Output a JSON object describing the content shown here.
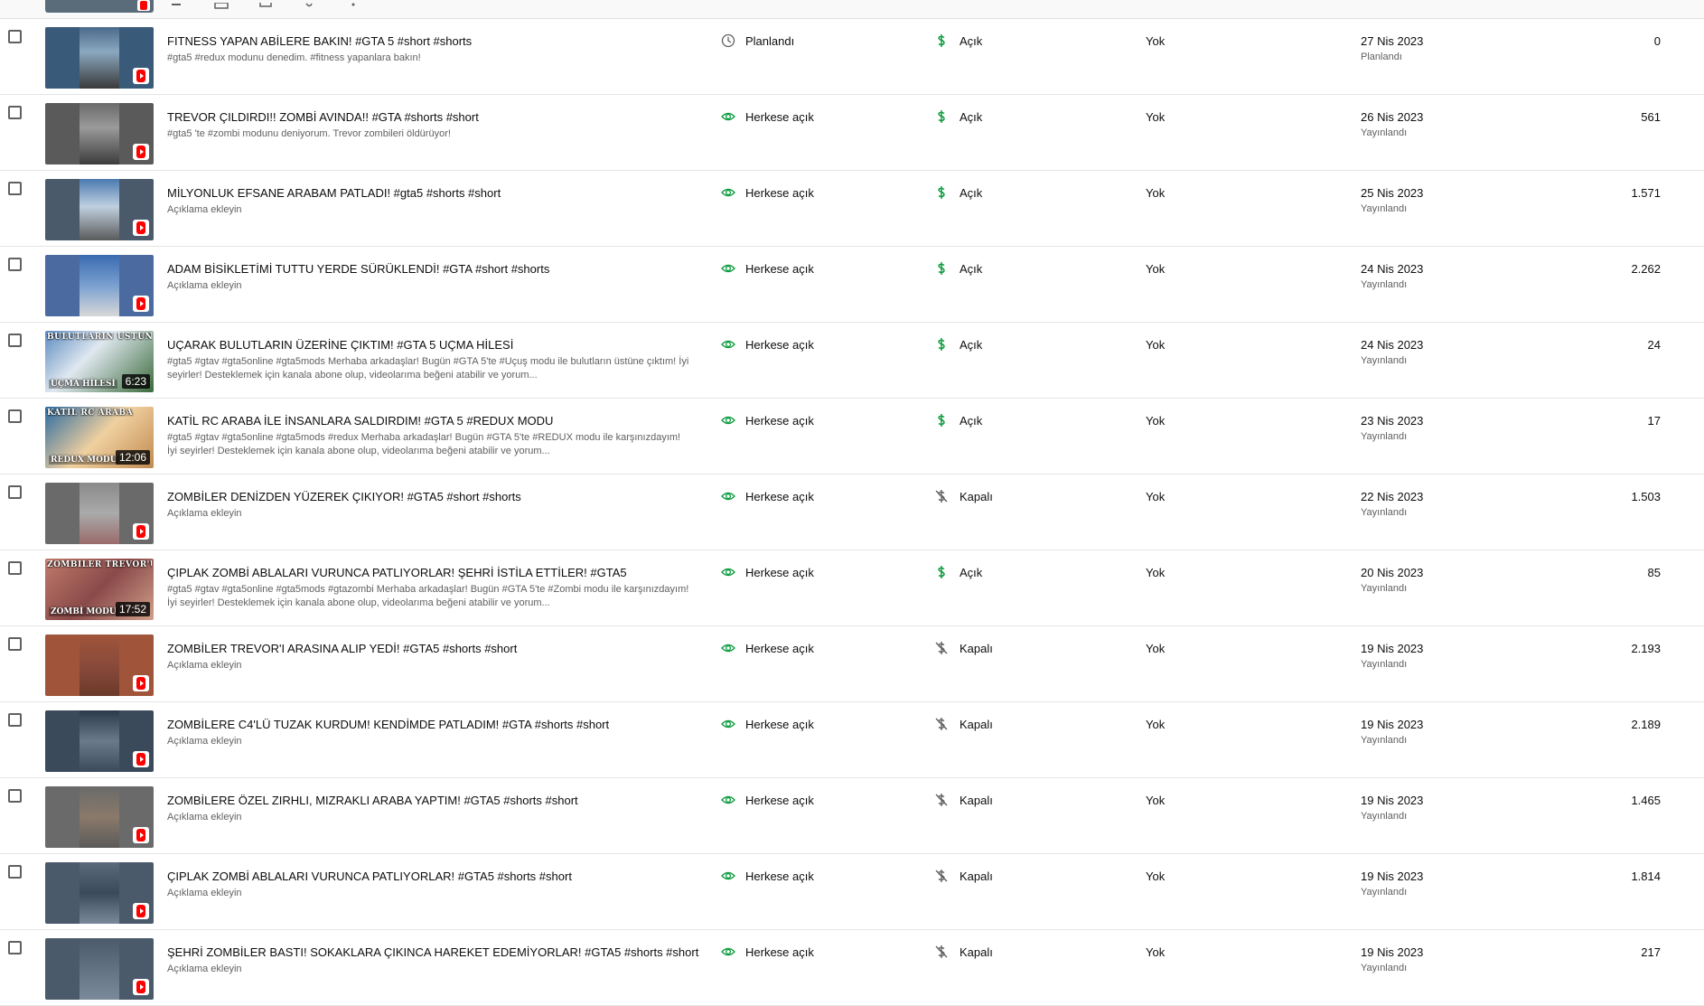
{
  "colors": {
    "money_on": "#0a9b3c",
    "icon_grey": "#606060",
    "shorts_red": "#ff0000"
  },
  "rows": [
    {
      "title": "FITNESS YAPAN ABİLERE BAKIN! #GTA 5 #short #shorts",
      "desc": "#gta5 #redux modunu denedim. #fitness yapanlara bakın!",
      "vis_icon": "clock-icon",
      "vis": "Planlandı",
      "mon_icon": "dollar-icon",
      "mon": "Açık",
      "restr": "Yok",
      "date": "27 Nis 2023",
      "status": "Planlandı",
      "views": "0",
      "thumb": "short"
    },
    {
      "title": "TREVOR ÇILDIRDI!! ZOMBİ AVINDA!! #GTA #shorts #short",
      "desc": "#gta5 'te #zombi modunu deniyorum. Trevor zombileri öldürüyor!",
      "vis_icon": "eye-icon",
      "vis": "Herkese açık",
      "mon_icon": "dollar-icon",
      "mon": "Açık",
      "restr": "Yok",
      "date": "26 Nis 2023",
      "status": "Yayınlandı",
      "views": "561",
      "thumb": "short"
    },
    {
      "title": "MİLYONLUK EFSANE ARABAM PATLADI! #gta5 #shorts #short",
      "desc": "Açıklama ekleyin",
      "vis_icon": "eye-icon",
      "vis": "Herkese açık",
      "mon_icon": "dollar-icon",
      "mon": "Açık",
      "restr": "Yok",
      "date": "25 Nis 2023",
      "status": "Yayınlandı",
      "views": "1.571",
      "thumb": "short"
    },
    {
      "title": "ADAM BİSİKLETİMİ TUTTU YERDE SÜRÜKLENDİ! #GTA #short #shorts",
      "desc": "Açıklama ekleyin",
      "vis_icon": "eye-icon",
      "vis": "Herkese açık",
      "mon_icon": "dollar-icon",
      "mon": "Açık",
      "restr": "Yok",
      "date": "24 Nis 2023",
      "status": "Yayınlandı",
      "views": "2.262",
      "thumb": "short"
    },
    {
      "title": "UÇARAK BULUTLARIN ÜZERİNE ÇIKTIM! #GTA 5 UÇMA HİLESİ",
      "desc": "#gta5 #gtav #gta5online #gta5mods Merhaba arkadaşlar! Bugün #GTA 5'te #Uçuş modu ile bulutların üstüne çıktım! İyi seyirler! Desteklemek için kanala abone olup, videolarıma beğeni atabilir ve yorum...",
      "vis_icon": "eye-icon",
      "vis": "Herkese açık",
      "mon_icon": "dollar-icon",
      "mon": "Açık",
      "restr": "Yok",
      "date": "24 Nis 2023",
      "status": "Yayınlandı",
      "views": "24",
      "thumb": "video",
      "duration": "6:23",
      "overlay_top": "BULUTLARIN ÜSTÜNE ÇIKTIM",
      "overlay_bot": "UÇMA HİLESİ"
    },
    {
      "title": "KATİL RC ARABA İLE İNSANLARA SALDIRDIM! #GTA 5 #REDUX MODU",
      "desc": "#gta5 #gtav #gta5online #gta5mods #redux Merhaba arkadaşlar! Bugün #GTA 5'te #REDUX modu ile karşınızdayım! İyi seyirler! Desteklemek için kanala abone olup, videolarıma beğeni atabilir ve yorum...",
      "vis_icon": "eye-icon",
      "vis": "Herkese açık",
      "mon_icon": "dollar-icon",
      "mon": "Açık",
      "restr": "Yok",
      "date": "23 Nis 2023",
      "status": "Yayınlandı",
      "views": "17",
      "thumb": "video",
      "duration": "12:06",
      "overlay_top": "KATİL RC ARABA",
      "overlay_bot": "REDUX MODU"
    },
    {
      "title": "ZOMBİLER DENİZDEN YÜZEREK ÇIKIYOR! #GTA5 #short #shorts",
      "desc": "Açıklama ekleyin",
      "vis_icon": "eye-icon",
      "vis": "Herkese açık",
      "mon_icon": "dollar-off-icon",
      "mon": "Kapalı",
      "restr": "Yok",
      "date": "22 Nis 2023",
      "status": "Yayınlandı",
      "views": "1.503",
      "thumb": "short"
    },
    {
      "title": "ÇIPLAK ZOMBİ ABLALARI VURUNCA PATLIYORLAR! ŞEHRİ İSTİLA ETTİLER! #GTA5",
      "desc": "#gta5 #gtav #gta5online #gta5mods #gtazombi Merhaba arkadaşlar! Bugün #GTA 5'te #Zombi modu ile karşınızdayım! İyi seyirler! Desteklemek için kanala abone olup, videolarıma beğeni atabilir ve yorum...",
      "vis_icon": "eye-icon",
      "vis": "Herkese açık",
      "mon_icon": "dollar-icon",
      "mon": "Açık",
      "restr": "Yok",
      "date": "20 Nis 2023",
      "status": "Yayınlandı",
      "views": "85",
      "thumb": "video",
      "duration": "17:52",
      "overlay_top": "ZOMBİLER TREVOR'U YEDİ!",
      "overlay_bot": "ZOMBİ MODU"
    },
    {
      "title": "ZOMBİLER TREVOR'I ARASINA ALIP YEDİ! #GTA5 #shorts #short",
      "desc": "Açıklama ekleyin",
      "vis_icon": "eye-icon",
      "vis": "Herkese açık",
      "mon_icon": "dollar-off-icon",
      "mon": "Kapalı",
      "restr": "Yok",
      "date": "19 Nis 2023",
      "status": "Yayınlandı",
      "views": "2.193",
      "thumb": "short"
    },
    {
      "title": "ZOMBİLERE C4'LÜ TUZAK KURDUM! KENDİMDE PATLADIM! #GTA #shorts #short",
      "desc": "Açıklama ekleyin",
      "vis_icon": "eye-icon",
      "vis": "Herkese açık",
      "mon_icon": "dollar-off-icon",
      "mon": "Kapalı",
      "restr": "Yok",
      "date": "19 Nis 2023",
      "status": "Yayınlandı",
      "views": "2.189",
      "thumb": "short"
    },
    {
      "title": "ZOMBİLERE ÖZEL ZIRHLI, MIZRAKLI ARABA YAPTIM! #GTA5 #shorts #short",
      "desc": "Açıklama ekleyin",
      "vis_icon": "eye-icon",
      "vis": "Herkese açık",
      "mon_icon": "dollar-off-icon",
      "mon": "Kapalı",
      "restr": "Yok",
      "date": "19 Nis 2023",
      "status": "Yayınlandı",
      "views": "1.465",
      "thumb": "short"
    },
    {
      "title": "ÇIPLAK ZOMBİ ABLALARI VURUNCA PATLIYORLAR! #GTA5 #shorts #short",
      "desc": "Açıklama ekleyin",
      "vis_icon": "eye-icon",
      "vis": "Herkese açık",
      "mon_icon": "dollar-off-icon",
      "mon": "Kapalı",
      "restr": "Yok",
      "date": "19 Nis 2023",
      "status": "Yayınlandı",
      "views": "1.814",
      "thumb": "short"
    },
    {
      "title": "ŞEHRİ ZOMBİLER BASTI! SOKAKLARA ÇIKINCA HAREKET EDEMİYORLAR! #GTA5 #shorts #short",
      "desc": "Açıklama ekleyin",
      "vis_icon": "eye-icon",
      "vis": "Herkese açık",
      "mon_icon": "dollar-off-icon",
      "mon": "Kapalı",
      "restr": "Yok",
      "date": "19 Nis 2023",
      "status": "Yayınlandı",
      "views": "217",
      "thumb": "short"
    }
  ]
}
